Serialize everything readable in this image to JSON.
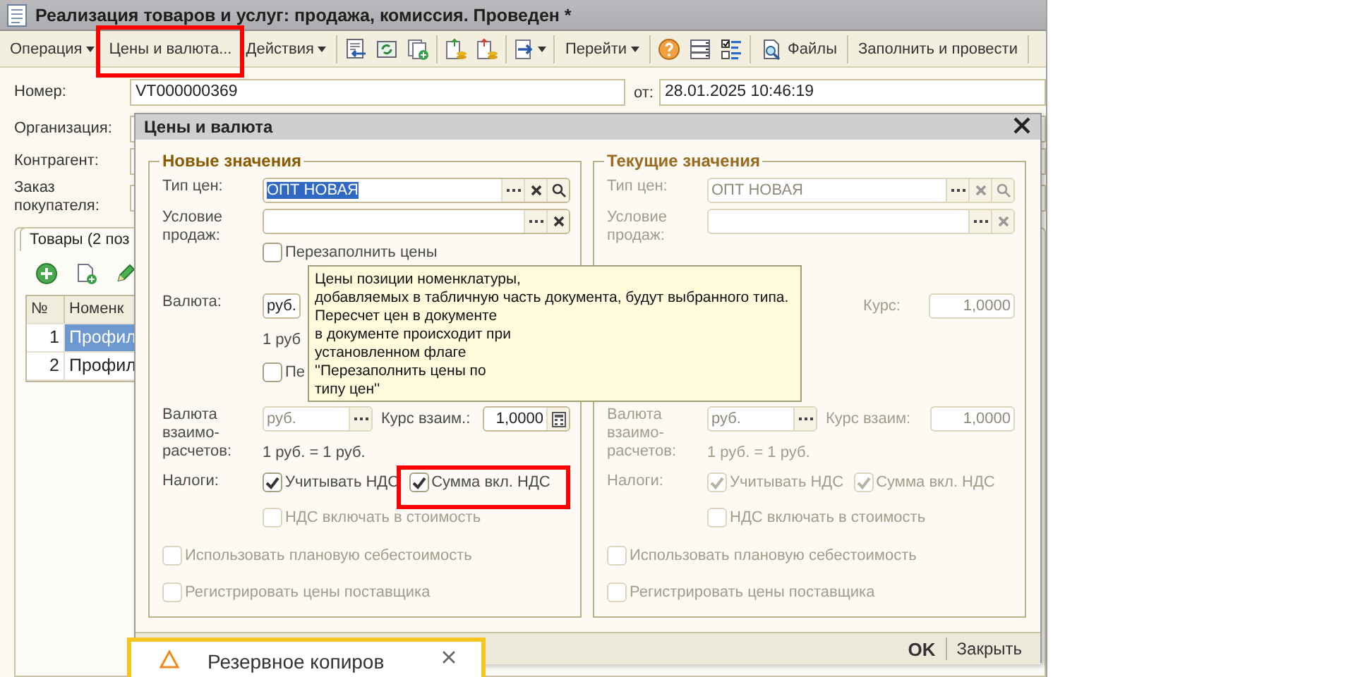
{
  "window": {
    "title": "Реализация товаров и услуг: продажа, комиссия. Проведен *"
  },
  "toolbar": [
    {
      "label": "Операция",
      "dropdown": true
    },
    {
      "label": "Цены и валюта...",
      "dropdown": false,
      "highlighted": true
    },
    {
      "label": "Действия",
      "dropdown": true
    },
    {
      "label": "Перейти",
      "dropdown": true
    },
    {
      "label": "Файлы",
      "dropdown": false
    },
    {
      "label": "Заполнить и провести",
      "dropdown": false
    }
  ],
  "header": {
    "number_label": "Номер:",
    "number": "VT000000369",
    "date_label": "от:",
    "date": "28.01.2025 10:46:19",
    "labels": [
      "Организация:",
      "Контрагент:",
      "Заказ покупателя:"
    ]
  },
  "tabs": [
    {
      "label": "Товары (2 поз",
      "selected": true
    }
  ],
  "table": {
    "columns": [
      "№",
      "Номенк"
    ],
    "rows": [
      {
        "cells": [
          "1",
          "Профил"
        ],
        "selected": true
      },
      {
        "cells": [
          "2",
          "Профил"
        ],
        "selected": false
      }
    ]
  },
  "dialog": {
    "title": "Цены и валюта",
    "groups": [
      {
        "title": "Новые значения",
        "disabled": false,
        "price_type": {
          "label": "Тип цен:",
          "value": "ОПТ НОВАЯ",
          "selected": true
        },
        "sale_condition": {
          "label": "Условие продаж:"
        },
        "refill": {
          "label": "Перезаполнить цены",
          "checked": false
        },
        "currency": {
          "label": "Валюта:",
          "value": "руб."
        },
        "currency_ratio": "1 руб",
        "refill_rate": {
          "label": "Пе",
          "checked": false
        },
        "settlement": {
          "label": "Валюта взаимо-расчетов:",
          "value": "руб.",
          "disabled": true,
          "rate_label": "Курс взаим.:",
          "rate": "1,0000",
          "ratio": "1 руб. = 1 руб."
        },
        "taxes": {
          "label": "Налоги:",
          "items": [
            {
              "label": "Учитывать НДС",
              "checked": true,
              "highlighted": false
            },
            {
              "label": "Сумма вкл. НДС",
              "checked": true,
              "highlighted": true
            }
          ],
          "extra": {
            "label": "НДС включать в стоимость",
            "checked": false,
            "disabled": true
          }
        },
        "options": [
          {
            "label": "Использовать плановую себестоимость",
            "checked": false,
            "disabled": true
          },
          {
            "label": "Регистрировать цены поставщика",
            "checked": false,
            "disabled": true
          }
        ]
      },
      {
        "title": "Текущие значения",
        "disabled": true,
        "price_type": {
          "label": "Тип цен:",
          "value": "ОПТ НОВАЯ",
          "selected": false
        },
        "sale_condition": {
          "label": "Условие продаж:"
        },
        "currency": {
          "rate_label": "Курс:",
          "rate": "1,0000"
        },
        "settlement": {
          "label": "Валюта взаимо-расчетов:",
          "value": "руб.",
          "rate_label": "Курс взаим:",
          "rate": "1,0000",
          "ratio": "1 руб. = 1 руб."
        },
        "taxes": {
          "label": "Налоги:",
          "items": [
            {
              "label": "Учитывать НДС",
              "checked": true,
              "highlighted": false
            },
            {
              "label": "Сумма вкл. НДС",
              "checked": true,
              "highlighted": false
            }
          ],
          "extra": {
            "label": "НДС включать в стоимость",
            "checked": false
          }
        },
        "options": [
          {
            "label": "Использовать плановую себестоимость",
            "checked": false
          },
          {
            "label": "Регистрировать цены поставщика",
            "checked": false
          }
        ]
      }
    ],
    "buttons": [
      {
        "label": "OK",
        "default": true
      },
      {
        "label": "Закрыть",
        "default": false
      }
    ]
  },
  "tooltip": {
    "text": "Цены позиции номенклатуры,\nдобавляемых в табличную часть документа, будут выбранного типа.\nПересчет цен в документе\nв документе происходит при\nустановленном флаге\n''Перезаполнить цены по\nтипу цен''"
  },
  "notification": {
    "text": "Резервное копиров"
  }
}
